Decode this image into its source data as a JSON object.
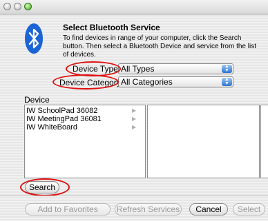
{
  "dialog": {
    "title": "Select Bluetooth Service",
    "description": "To find devices in range of your computer, click the Search button. Then select a Bluetooth Device and service from the list of devices."
  },
  "filters": {
    "device_type_label": "Device Type:",
    "device_type_value": "All Types",
    "device_category_label": "Device Category:",
    "device_category_value": "All Categories"
  },
  "device_list": {
    "header": "Device",
    "items": [
      "IW SchoolPad 36082",
      "IW MeetingPad 36081",
      "IW WhiteBoard"
    ]
  },
  "buttons": {
    "search": "Search",
    "add_to_favorites": "Add to Favorites",
    "refresh_services": "Refresh Services",
    "cancel": "Cancel",
    "select": "Select"
  },
  "colors": {
    "annotation_red": "#e01010",
    "bluetooth_blue": "#1b64d6"
  }
}
